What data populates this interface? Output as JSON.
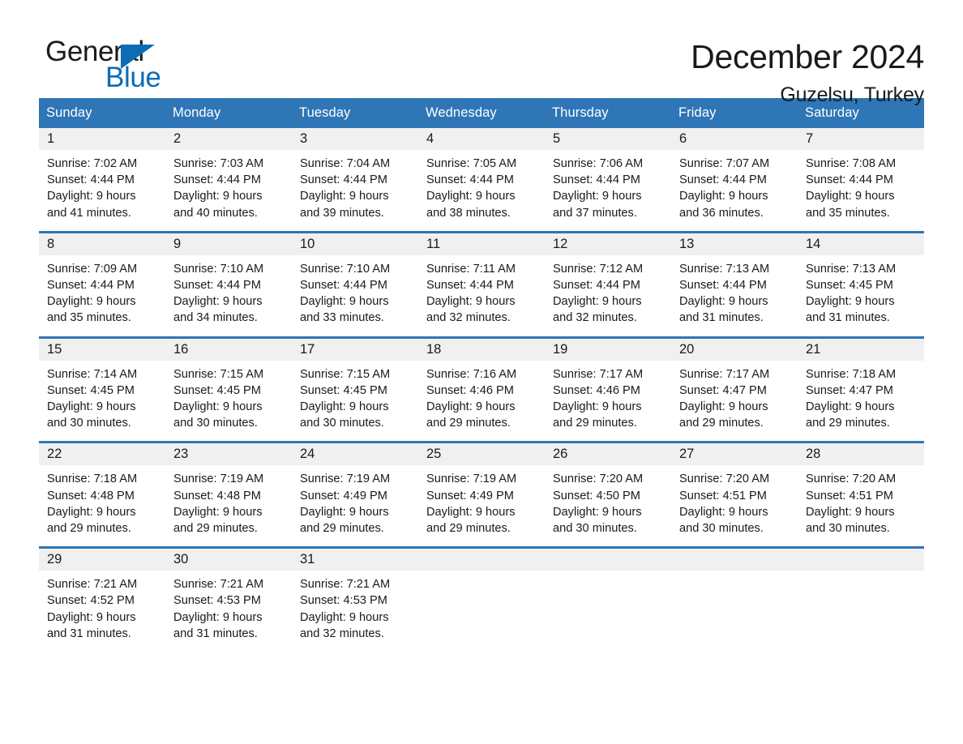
{
  "brand": {
    "word_one": "General",
    "word_two": "Blue",
    "flag_icon": "triangle-flag-icon",
    "accent_color": "#0d6cb4"
  },
  "header": {
    "title": "December 2024",
    "location": "Guzelsu, Turkey"
  },
  "theme": {
    "header_blue": "#2e76b6",
    "band_gray": "#f0f0f0",
    "text": "#1a1a1a"
  },
  "calendar": {
    "day_headers": [
      "Sunday",
      "Monday",
      "Tuesday",
      "Wednesday",
      "Thursday",
      "Friday",
      "Saturday"
    ],
    "weeks": [
      {
        "days": [
          {
            "num": "1",
            "info": "Sunrise: 7:02 AM\nSunset: 4:44 PM\nDaylight: 9 hours\nand 41 minutes."
          },
          {
            "num": "2",
            "info": "Sunrise: 7:03 AM\nSunset: 4:44 PM\nDaylight: 9 hours\nand 40 minutes."
          },
          {
            "num": "3",
            "info": "Sunrise: 7:04 AM\nSunset: 4:44 PM\nDaylight: 9 hours\nand 39 minutes."
          },
          {
            "num": "4",
            "info": "Sunrise: 7:05 AM\nSunset: 4:44 PM\nDaylight: 9 hours\nand 38 minutes."
          },
          {
            "num": "5",
            "info": "Sunrise: 7:06 AM\nSunset: 4:44 PM\nDaylight: 9 hours\nand 37 minutes."
          },
          {
            "num": "6",
            "info": "Sunrise: 7:07 AM\nSunset: 4:44 PM\nDaylight: 9 hours\nand 36 minutes."
          },
          {
            "num": "7",
            "info": "Sunrise: 7:08 AM\nSunset: 4:44 PM\nDaylight: 9 hours\nand 35 minutes."
          }
        ]
      },
      {
        "days": [
          {
            "num": "8",
            "info": "Sunrise: 7:09 AM\nSunset: 4:44 PM\nDaylight: 9 hours\nand 35 minutes."
          },
          {
            "num": "9",
            "info": "Sunrise: 7:10 AM\nSunset: 4:44 PM\nDaylight: 9 hours\nand 34 minutes."
          },
          {
            "num": "10",
            "info": "Sunrise: 7:10 AM\nSunset: 4:44 PM\nDaylight: 9 hours\nand 33 minutes."
          },
          {
            "num": "11",
            "info": "Sunrise: 7:11 AM\nSunset: 4:44 PM\nDaylight: 9 hours\nand 32 minutes."
          },
          {
            "num": "12",
            "info": "Sunrise: 7:12 AM\nSunset: 4:44 PM\nDaylight: 9 hours\nand 32 minutes."
          },
          {
            "num": "13",
            "info": "Sunrise: 7:13 AM\nSunset: 4:44 PM\nDaylight: 9 hours\nand 31 minutes."
          },
          {
            "num": "14",
            "info": "Sunrise: 7:13 AM\nSunset: 4:45 PM\nDaylight: 9 hours\nand 31 minutes."
          }
        ]
      },
      {
        "days": [
          {
            "num": "15",
            "info": "Sunrise: 7:14 AM\nSunset: 4:45 PM\nDaylight: 9 hours\nand 30 minutes."
          },
          {
            "num": "16",
            "info": "Sunrise: 7:15 AM\nSunset: 4:45 PM\nDaylight: 9 hours\nand 30 minutes."
          },
          {
            "num": "17",
            "info": "Sunrise: 7:15 AM\nSunset: 4:45 PM\nDaylight: 9 hours\nand 30 minutes."
          },
          {
            "num": "18",
            "info": "Sunrise: 7:16 AM\nSunset: 4:46 PM\nDaylight: 9 hours\nand 29 minutes."
          },
          {
            "num": "19",
            "info": "Sunrise: 7:17 AM\nSunset: 4:46 PM\nDaylight: 9 hours\nand 29 minutes."
          },
          {
            "num": "20",
            "info": "Sunrise: 7:17 AM\nSunset: 4:47 PM\nDaylight: 9 hours\nand 29 minutes."
          },
          {
            "num": "21",
            "info": "Sunrise: 7:18 AM\nSunset: 4:47 PM\nDaylight: 9 hours\nand 29 minutes."
          }
        ]
      },
      {
        "days": [
          {
            "num": "22",
            "info": "Sunrise: 7:18 AM\nSunset: 4:48 PM\nDaylight: 9 hours\nand 29 minutes."
          },
          {
            "num": "23",
            "info": "Sunrise: 7:19 AM\nSunset: 4:48 PM\nDaylight: 9 hours\nand 29 minutes."
          },
          {
            "num": "24",
            "info": "Sunrise: 7:19 AM\nSunset: 4:49 PM\nDaylight: 9 hours\nand 29 minutes."
          },
          {
            "num": "25",
            "info": "Sunrise: 7:19 AM\nSunset: 4:49 PM\nDaylight: 9 hours\nand 29 minutes."
          },
          {
            "num": "26",
            "info": "Sunrise: 7:20 AM\nSunset: 4:50 PM\nDaylight: 9 hours\nand 30 minutes."
          },
          {
            "num": "27",
            "info": "Sunrise: 7:20 AM\nSunset: 4:51 PM\nDaylight: 9 hours\nand 30 minutes."
          },
          {
            "num": "28",
            "info": "Sunrise: 7:20 AM\nSunset: 4:51 PM\nDaylight: 9 hours\nand 30 minutes."
          }
        ]
      },
      {
        "days": [
          {
            "num": "29",
            "info": "Sunrise: 7:21 AM\nSunset: 4:52 PM\nDaylight: 9 hours\nand 31 minutes."
          },
          {
            "num": "30",
            "info": "Sunrise: 7:21 AM\nSunset: 4:53 PM\nDaylight: 9 hours\nand 31 minutes."
          },
          {
            "num": "31",
            "info": "Sunrise: 7:21 AM\nSunset: 4:53 PM\nDaylight: 9 hours\nand 32 minutes."
          },
          {
            "num": "",
            "info": ""
          },
          {
            "num": "",
            "info": ""
          },
          {
            "num": "",
            "info": ""
          },
          {
            "num": "",
            "info": ""
          }
        ]
      }
    ]
  }
}
